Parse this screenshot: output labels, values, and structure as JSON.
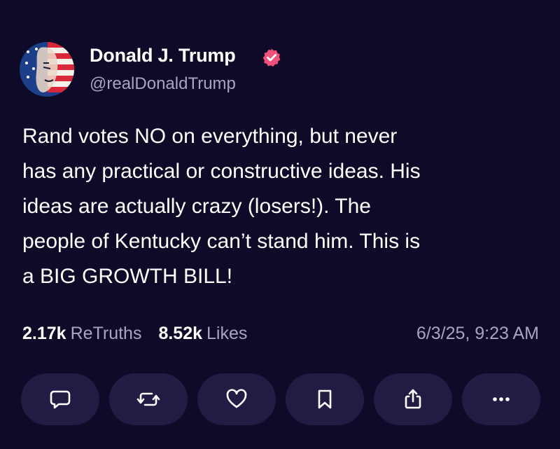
{
  "author": {
    "name": "Donald J. Trump",
    "handle": "@realDonaldTrump",
    "verified": true,
    "avatar_icon": "flag-portrait-avatar"
  },
  "post": {
    "lines": [
      "Rand votes NO on everything, but never",
      "has any practical or constructive ideas. His",
      "ideas are actually crazy (losers!). The",
      "people of Kentucky can’t stand him. This is",
      "a BIG GROWTH BILL!"
    ]
  },
  "stats": {
    "retruths_count": "2.17k",
    "retruths_label": "ReTruths",
    "likes_count": "8.52k",
    "likes_label": "Likes",
    "timestamp": "6/3/25, 9:23 AM"
  },
  "actions": [
    {
      "name": "reply",
      "icon": "chat-bubble-icon"
    },
    {
      "name": "retruth",
      "icon": "repost-arrows-icon"
    },
    {
      "name": "like",
      "icon": "heart-icon"
    },
    {
      "name": "bookmark",
      "icon": "bookmark-icon"
    },
    {
      "name": "share",
      "icon": "share-icon"
    },
    {
      "name": "more",
      "icon": "ellipsis-icon"
    }
  ],
  "colors": {
    "background": "#0f0a27",
    "button_bg": "#221c44",
    "muted_text": "#a8a5bd",
    "verified_badge": "#f0517a"
  }
}
